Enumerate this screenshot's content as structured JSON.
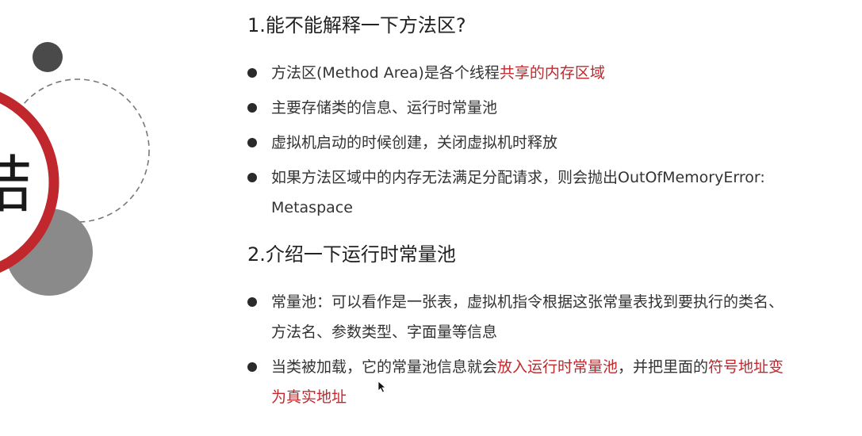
{
  "colors": {
    "accent_red": "#c0282d",
    "dark_gray": "#4a4a4a",
    "mid_gray": "#8a8a8a",
    "text": "#333333"
  },
  "decoration": {
    "big_char": "结"
  },
  "section1": {
    "heading": "1.能不能解释一下方法区?",
    "items": [
      {
        "t1": "方法区(Method Area)是各个线程",
        "hl1": "共享的内存区域"
      },
      {
        "t1": "主要存储类的信息、运行时常量池"
      },
      {
        "t1": "虚拟机启动的时候创建，关闭虚拟机时释放"
      },
      {
        "t1": "如果方法区域中的内存无法满足分配请求，则会抛出OutOfMemoryError:",
        "t2": "Metaspace"
      }
    ]
  },
  "section2": {
    "heading": "2.介绍一下运行时常量池",
    "items": [
      {
        "t1": "常量池：可以看作是一张表，虚拟机指令根据这张常量表找到要执行的类名、",
        "t2": "方法名、参数类型、字面量等信息"
      },
      {
        "t1": "当类被加载，它的常量池信息就会",
        "hl1": "放入运行时常量池",
        "t2": "，并把里面的",
        "hl2": "符号地址变",
        "hl3": "为真实地址"
      }
    ]
  }
}
